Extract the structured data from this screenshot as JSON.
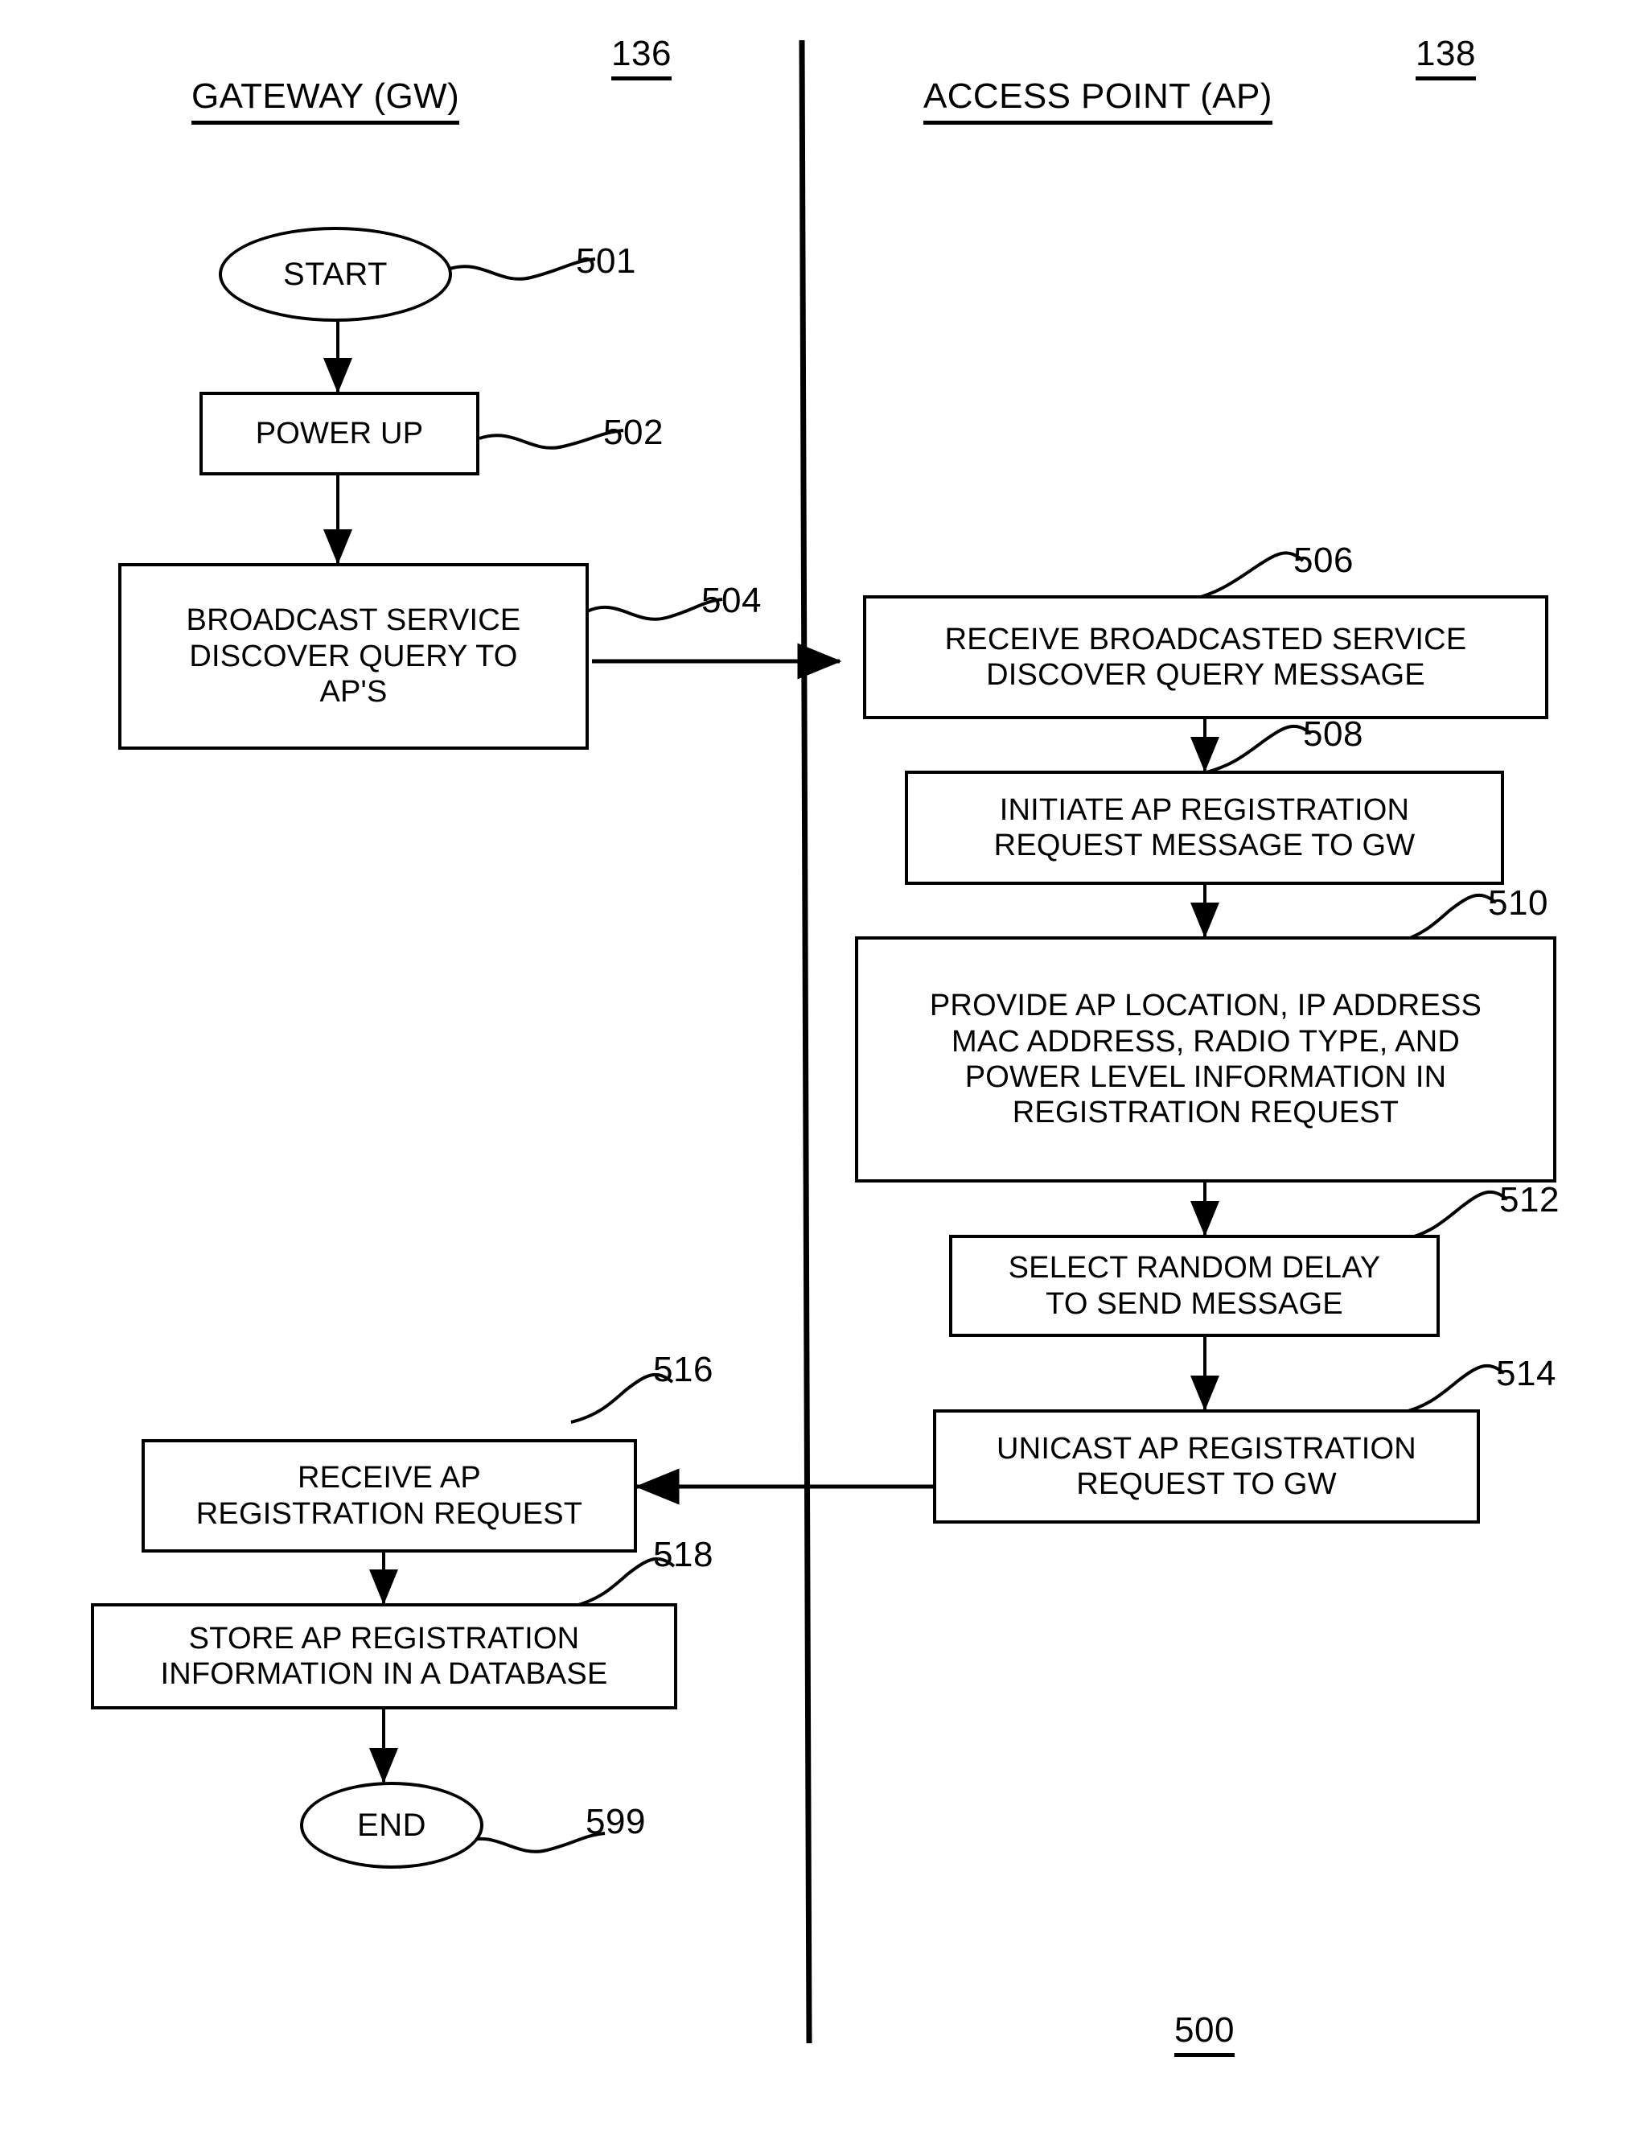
{
  "figure": {
    "figure_label": "500",
    "columns": [
      {
        "id": "gateway",
        "title": "GATEWAY (GW)",
        "ref": "136"
      },
      {
        "id": "access_point",
        "title": "ACCESS POINT (AP)",
        "ref": "138"
      }
    ],
    "nodes": [
      {
        "id": "n501",
        "ref": "501",
        "shape": "ellipse",
        "column": "gateway",
        "text": "START"
      },
      {
        "id": "n502",
        "ref": "502",
        "shape": "rect",
        "column": "gateway",
        "text": "POWER UP"
      },
      {
        "id": "n504",
        "ref": "504",
        "shape": "rect",
        "column": "gateway",
        "text": "BROADCAST SERVICE\nDISCOVER QUERY TO\nAP'S"
      },
      {
        "id": "n506",
        "ref": "506",
        "shape": "rect",
        "column": "access_point",
        "text": "RECEIVE BROADCASTED SERVICE\nDISCOVER QUERY MESSAGE"
      },
      {
        "id": "n508",
        "ref": "508",
        "shape": "rect",
        "column": "access_point",
        "text": "INITIATE AP REGISTRATION\nREQUEST MESSAGE TO GW"
      },
      {
        "id": "n510",
        "ref": "510",
        "shape": "rect",
        "column": "access_point",
        "text": "PROVIDE AP LOCATION, IP ADDRESS\nMAC ADDRESS, RADIO TYPE, AND\nPOWER LEVEL INFORMATION IN\nREGISTRATION REQUEST"
      },
      {
        "id": "n512",
        "ref": "512",
        "shape": "rect",
        "column": "access_point",
        "text": "SELECT RANDOM DELAY\nTO SEND MESSAGE"
      },
      {
        "id": "n514",
        "ref": "514",
        "shape": "rect",
        "column": "access_point",
        "text": "UNICAST AP REGISTRATION\nREQUEST TO GW"
      },
      {
        "id": "n516",
        "ref": "516",
        "shape": "rect",
        "column": "gateway",
        "text": "RECEIVE AP\nREGISTRATION REQUEST"
      },
      {
        "id": "n518",
        "ref": "518",
        "shape": "rect",
        "column": "gateway",
        "text": "STORE AP REGISTRATION\nINFORMATION IN A DATABASE"
      },
      {
        "id": "n599",
        "ref": "599",
        "shape": "ellipse",
        "column": "gateway",
        "text": "END"
      }
    ],
    "edges": [
      {
        "from": "n501",
        "to": "n502",
        "direction": "down"
      },
      {
        "from": "n502",
        "to": "n504",
        "direction": "down"
      },
      {
        "from": "n504",
        "to": "n506",
        "direction": "right"
      },
      {
        "from": "n506",
        "to": "n508",
        "direction": "down"
      },
      {
        "from": "n508",
        "to": "n510",
        "direction": "down"
      },
      {
        "from": "n510",
        "to": "n512",
        "direction": "down"
      },
      {
        "from": "n512",
        "to": "n514",
        "direction": "down"
      },
      {
        "from": "n514",
        "to": "n516",
        "direction": "left"
      },
      {
        "from": "n516",
        "to": "n518",
        "direction": "down"
      },
      {
        "from": "n518",
        "to": "n599",
        "direction": "down"
      }
    ]
  }
}
